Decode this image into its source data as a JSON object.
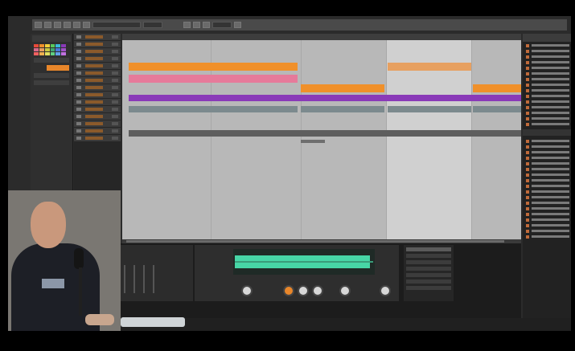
{
  "app": {
    "name": "",
    "status_items": [
      "",
      "",
      "",
      ""
    ]
  },
  "colors": {
    "orange_clip": "#f0902a",
    "pink_clip": "#e67a9a",
    "purple_clip": "#8a3ab8",
    "waveform": "#47d6a6",
    "accent": "#e8862a"
  },
  "toolbar": {
    "icons": [
      "menu-icon",
      "play-icon",
      "stop-icon",
      "record-icon",
      "loop-icon",
      "metronome-icon"
    ]
  },
  "browser": {
    "sections": [
      "",
      ""
    ]
  }
}
